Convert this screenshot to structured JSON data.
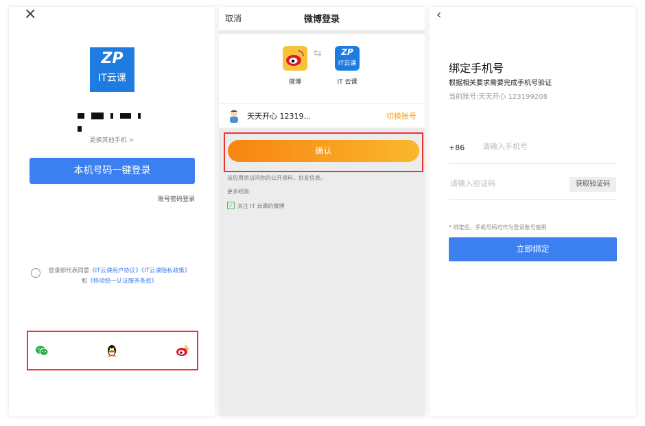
{
  "login_screen": {
    "masked_number": "",
    "switch_phone": "更换其他手机 >",
    "one_key_login": "本机号码一键登录",
    "password_login": "账号密码登录",
    "agreement_prefix": "登录即代表同意",
    "agreement_user": "《IT云课用户协议》",
    "agreement_privacy": "《IT云课隐私政策》",
    "agreement_and": "和",
    "agreement_service": "《移动统一认证服务条款》",
    "logo_text": "IT云课",
    "logo_mark": "ZP",
    "social": [
      "wechat-icon",
      "qq-icon",
      "weibo-icon"
    ]
  },
  "weibo_screen": {
    "cancel": "取消",
    "title": "微博登录",
    "weibo_label": "微博",
    "itcloud_label": "IT 云课",
    "itcloud_mark": "ZP",
    "itcloud_text": "IT云课",
    "account_name": "天天开心 12319...",
    "switch_account": "切换账号",
    "confirm": "确认",
    "permission_desc": "该应用将访问你的公开资料，好友信息。",
    "more_permissions": "更多权限:",
    "follow_label": "关注 IT 云课的微博",
    "arrows": "⇆"
  },
  "bind_screen": {
    "title": "绑定手机号",
    "subtitle": "根据相关要求需要完成手机号验证",
    "current_account": "当前账号:天天开心 123199208",
    "country_code": "+86",
    "phone_placeholder": "请输入手机号",
    "code_placeholder": "请输入验证码",
    "get_code": "获取验证码",
    "note": "* 绑定后，手机号码可作为登录账号使用",
    "bind_now": "立即绑定"
  },
  "colors": {
    "primary_blue": "#3b7ff0",
    "orange": "#f29b1a",
    "highlight_red": "#ee3333"
  }
}
